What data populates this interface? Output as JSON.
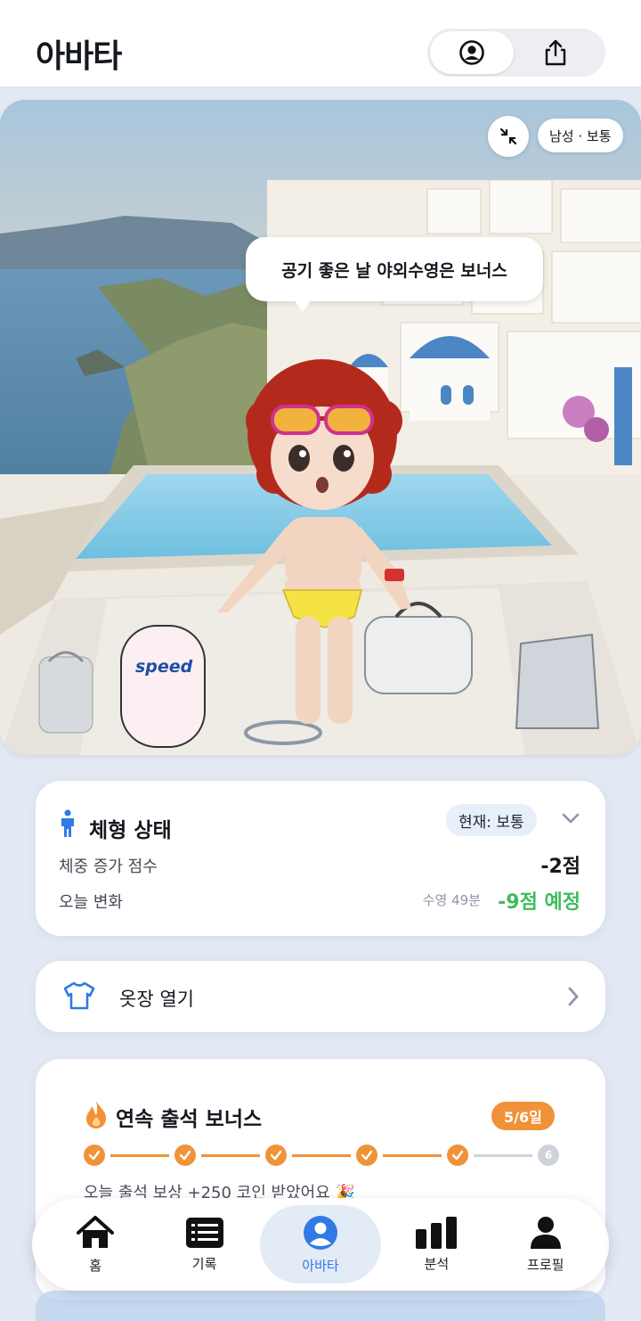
{
  "header": {
    "title": "아바타"
  },
  "scene": {
    "body_type": "남성 · 보통",
    "speech": "공기 좋은 날 야외수영은 보너스",
    "kickboard_brand": "speed"
  },
  "body_status": {
    "title": "체형 상태",
    "current": "현재: 보통",
    "weight_label": "체중 증가 점수",
    "weight_value": "-2점",
    "today_label": "오늘 변화",
    "swim_note": "수영 49분",
    "today_value": "-9점 예정"
  },
  "closet": {
    "label": "옷장 열기"
  },
  "streak": {
    "title": "연속 출석 보너스",
    "badge": "5/6일",
    "done_days": 5,
    "total_days": 6,
    "last_day_label": "6",
    "reward": "오늘 출석 보상 +250 코인 받았어요 🎉"
  },
  "tabs": [
    {
      "label": "홈",
      "icon": "home-icon"
    },
    {
      "label": "기록",
      "icon": "list-icon"
    },
    {
      "label": "아바타",
      "icon": "avatar-icon"
    },
    {
      "label": "분석",
      "icon": "bar-chart-icon"
    },
    {
      "label": "프로필",
      "icon": "profile-icon"
    }
  ],
  "colors": {
    "accent": "#2f7ae5",
    "streak": "#f19239",
    "green": "#3dbd5d"
  }
}
